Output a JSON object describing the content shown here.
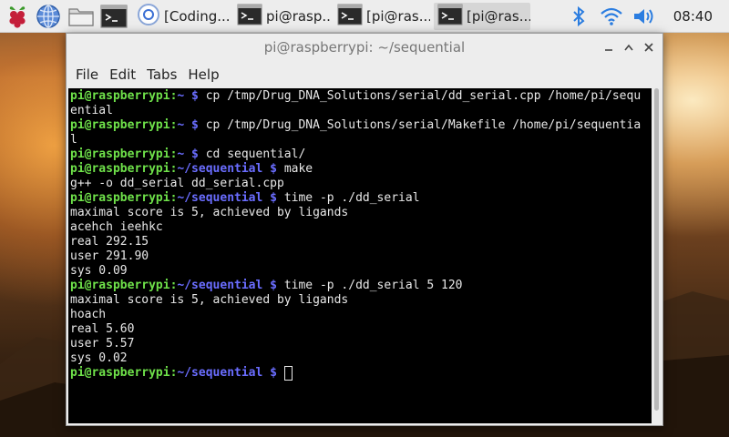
{
  "taskbar": {
    "tasks": [
      {
        "label": "[Coding..."
      },
      {
        "label": "pi@rasp..."
      },
      {
        "label": "[pi@ras..."
      },
      {
        "label": "[pi@ras..."
      }
    ],
    "clock": "08:40"
  },
  "window": {
    "title": "pi@raspberrypi: ~/sequential",
    "menu": [
      "File",
      "Edit",
      "Tabs",
      "Help"
    ]
  },
  "terminal": {
    "user": "pi@raspberrypi",
    "lines": [
      {
        "type": "prompt",
        "path": "~",
        "cmd": "cp /tmp/Drug_DNA_Solutions/serial/dd_serial.cpp /home/pi/sequ"
      },
      {
        "type": "out",
        "text": "ential"
      },
      {
        "type": "prompt",
        "path": "~",
        "cmd": "cp /tmp/Drug_DNA_Solutions/serial/Makefile /home/pi/sequentia"
      },
      {
        "type": "out",
        "text": "l"
      },
      {
        "type": "prompt",
        "path": "~",
        "cmd": "cd sequential/"
      },
      {
        "type": "prompt",
        "path": "~/sequential",
        "cmd": "make"
      },
      {
        "type": "out",
        "text": "g++ -o dd_serial dd_serial.cpp"
      },
      {
        "type": "prompt",
        "path": "~/sequential",
        "cmd": "time -p ./dd_serial"
      },
      {
        "type": "out",
        "text": "maximal score is 5, achieved by ligands"
      },
      {
        "type": "out",
        "text": "acehch ieehkc"
      },
      {
        "type": "out",
        "text": "real 292.15"
      },
      {
        "type": "out",
        "text": "user 291.90"
      },
      {
        "type": "out",
        "text": "sys 0.09"
      },
      {
        "type": "prompt",
        "path": "~/sequential",
        "cmd": "time -p ./dd_serial 5 120"
      },
      {
        "type": "out",
        "text": "maximal score is 5, achieved by ligands"
      },
      {
        "type": "out",
        "text": "hoach"
      },
      {
        "type": "out",
        "text": "real 5.60"
      },
      {
        "type": "out",
        "text": "user 5.57"
      },
      {
        "type": "out",
        "text": "sys 0.02"
      },
      {
        "type": "prompt",
        "path": "~/sequential",
        "cmd": "",
        "cursor": true
      }
    ]
  }
}
